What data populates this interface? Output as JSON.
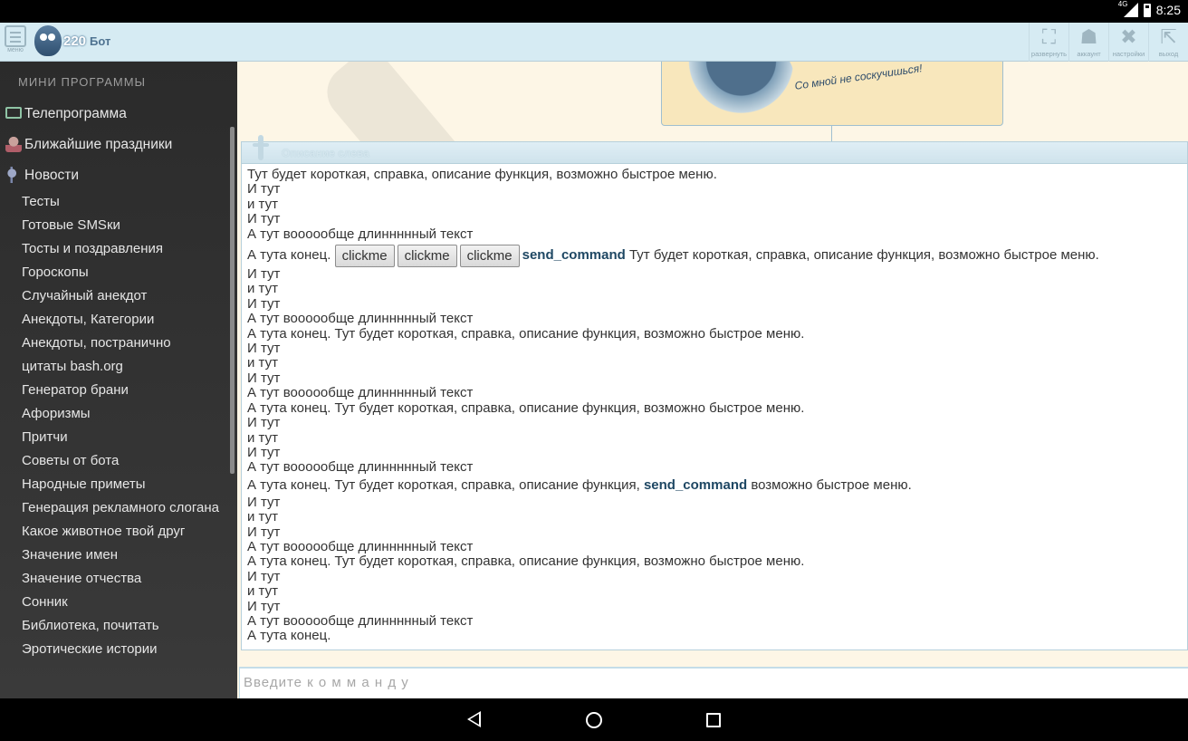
{
  "statusbar": {
    "network": "4G",
    "time": "8:25"
  },
  "header": {
    "menu_caption": "меню",
    "logo_number": "220",
    "logo_name": "Бот",
    "tools": [
      {
        "icon": "expand-icon",
        "caption": "развернуть"
      },
      {
        "icon": "account-icon",
        "caption": "аккаунт"
      },
      {
        "icon": "settings-icon",
        "caption": "настройки"
      },
      {
        "icon": "exit-icon",
        "caption": "выход"
      }
    ]
  },
  "sidebar": {
    "section_title": "МИНИ ПРОГРАММЫ",
    "icon_items": [
      {
        "icon": "tv-icon",
        "label": "Телепрограмма"
      },
      {
        "icon": "holiday-icon",
        "label": "Ближайшие праздники"
      },
      {
        "icon": "news-icon",
        "label": "Новости"
      }
    ],
    "items": [
      "Тесты",
      "Готовые SMSки",
      "Тосты и поздравления",
      "Гороскопы",
      "Случайный анекдот",
      "Анекдоты, Категории",
      "Анекдоты, постранично",
      "цитаты bash.org",
      "Генератор брани",
      "Афоризмы",
      "Притчи",
      "Советы от бота",
      "Народные приметы",
      "Генерация рекламного слогана",
      "Какое животное твой друг",
      "Значение имен",
      "Значение отчества",
      "Сонник",
      "Библиотека, почитать",
      "Эротические истории"
    ]
  },
  "banner": {
    "slogan": "Со мной не соскучишься!"
  },
  "panel": {
    "title": "Описание слева",
    "intro": "Тут будет короткая, справка, описание функция, возможно быстрое меню.",
    "i_tut_cap": "И тут",
    "i_tut": "и тут",
    "long_text": "А тут воооообще длиннннный текст",
    "end_prefix": "А тута конец.",
    "end_full": "А тута конец. Тут будет короткая, справка, описание функция, возможно быстрое меню.",
    "end_only": "А тута конец.",
    "buttons": [
      "clickme",
      "clickme",
      "clickme"
    ],
    "command": "send_command",
    "after_command": "Тут будет короткая, справка, описание функция, возможно быстрое меню.",
    "cmd_line_prefix": "А тута конец. Тут будет короткая, справка, описание функция,",
    "cmd_line_suffix": "возможно быстрое меню."
  },
  "input": {
    "placeholder": "Введите к о м м а н д у"
  }
}
